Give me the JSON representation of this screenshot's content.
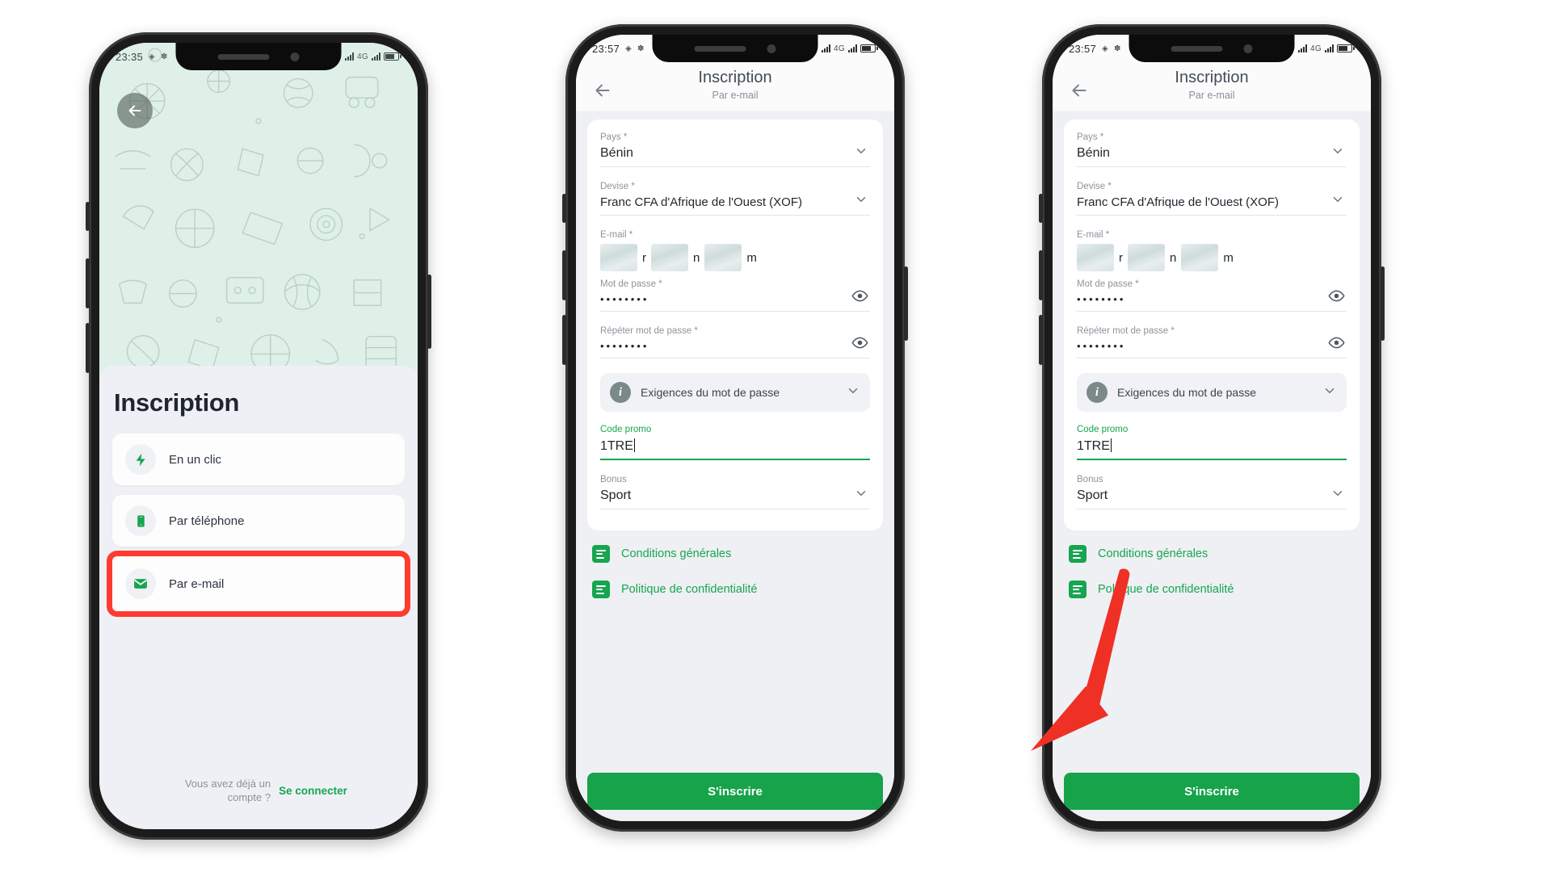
{
  "phone1": {
    "status": {
      "time": "23:35"
    },
    "back_icon": "back-arrow-icon",
    "title": "Inscription",
    "options": [
      {
        "label": "En un clic",
        "icon": "lightning-icon"
      },
      {
        "label": "Par téléphone",
        "icon": "phone-icon"
      },
      {
        "label": "Par e-mail",
        "icon": "envelope-icon"
      }
    ],
    "highlight_color": "#ff3b30",
    "footer": {
      "question": "Vous avez déjà un compte ?",
      "link": "Se connecter"
    }
  },
  "phone2": {
    "status": {
      "time": "23:57"
    },
    "header": {
      "title": "Inscription",
      "subtitle": "Par e-mail"
    },
    "fields": {
      "country": {
        "label": "Pays *",
        "value": "Bénin"
      },
      "currency": {
        "label": "Devise *",
        "value": "Franc CFA d'Afrique de l'Ouest (XOF)"
      },
      "email": {
        "label": "E-mail *",
        "value": "m",
        "redacted": true
      },
      "password": {
        "label": "Mot de passe *",
        "value": "••••••••"
      },
      "password_repeat": {
        "label": "Répéter mot de passe *",
        "value": "••••••••"
      },
      "promo": {
        "label": "Code promo",
        "value": "1TRE"
      },
      "bonus": {
        "label": "Bonus",
        "value": "Sport"
      }
    },
    "requirements_row": "Exigences du mot de passe",
    "links": [
      "Conditions générales",
      "Politique de confidentialité"
    ],
    "submit_label": "S'inscrire",
    "accent_color": "#16a34a"
  },
  "phone3": {
    "status": {
      "time": "23:57"
    },
    "header": {
      "title": "Inscription",
      "subtitle": "Par e-mail"
    },
    "fields": {
      "country": {
        "label": "Pays *",
        "value": "Bénin"
      },
      "currency": {
        "label": "Devise *",
        "value": "Franc CFA d'Afrique de l'Ouest (XOF)"
      },
      "email": {
        "label": "E-mail *",
        "value": "m",
        "redacted": true
      },
      "password": {
        "label": "Mot de passe *",
        "value": "••••••••"
      },
      "password_repeat": {
        "label": "Répéter mot de passe *",
        "value": "••••••••"
      },
      "promo": {
        "label": "Code promo",
        "value": "1TRE"
      },
      "bonus": {
        "label": "Bonus",
        "value": "Sport"
      }
    },
    "requirements_row": "Exigences du mot de passe",
    "links": [
      "Conditions générales",
      "Politique de confidentialité"
    ],
    "submit_label": "S'inscrire",
    "annotation": {
      "type": "arrow",
      "color": "#ee3124",
      "points_to": "submit-button"
    }
  }
}
